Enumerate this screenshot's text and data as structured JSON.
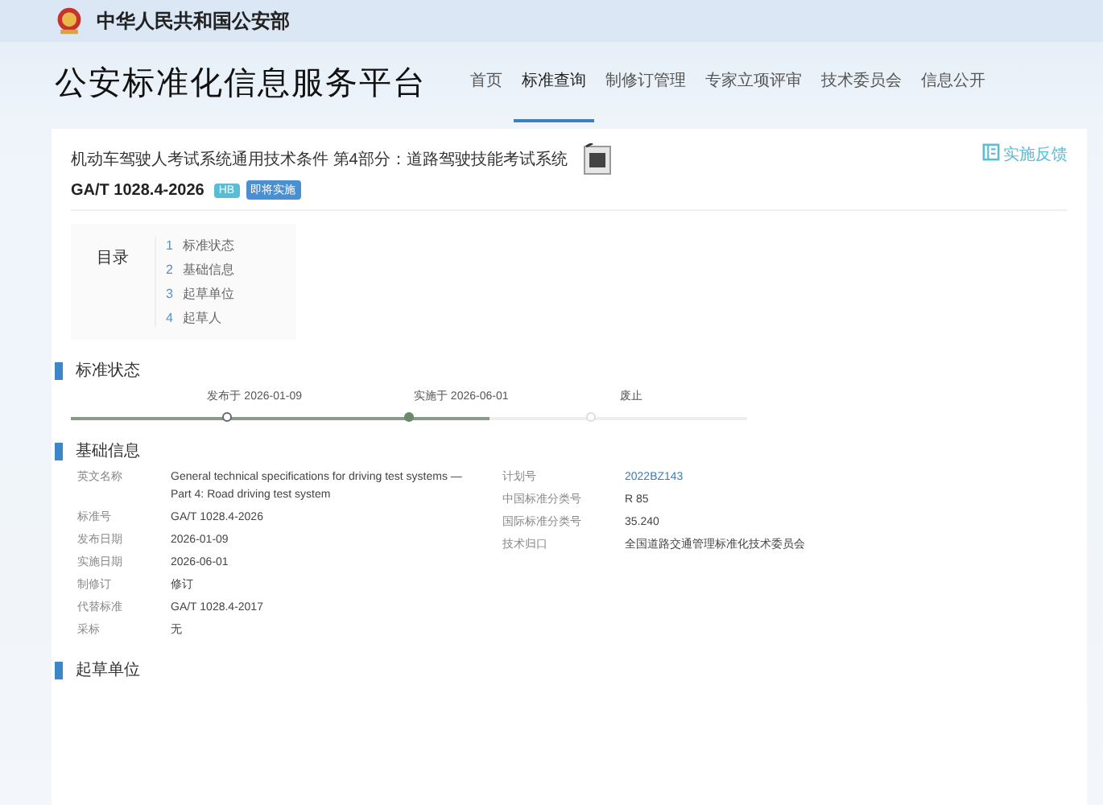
{
  "header": {
    "ministry": "中华人民共和国公安部"
  },
  "platform": {
    "title": "公安标准化信息服务平台"
  },
  "nav": [
    {
      "label": "首页",
      "selected": false
    },
    {
      "label": "标准查询",
      "selected": true
    },
    {
      "label": "制修订管理",
      "selected": false
    },
    {
      "label": "专家立项评审",
      "selected": false
    },
    {
      "label": "技术委员会",
      "selected": false
    },
    {
      "label": "信息公开",
      "selected": false
    }
  ],
  "standard": {
    "title": "机动车驾驶人考试系统通用技术条件 第4部分：道路驾驶技能考试系统",
    "code": "GA/T 1028.4-2026",
    "badges": [
      {
        "label": "HB",
        "color": "#5bbcd6"
      },
      {
        "label": "即将实施",
        "color": "#4a8fd0"
      }
    ],
    "feedback": "实施反馈"
  },
  "toc": {
    "title": "目录",
    "items": [
      {
        "number": "1",
        "label": "标准状态"
      },
      {
        "number": "2",
        "label": "基础信息"
      },
      {
        "number": "3",
        "label": "起草单位"
      },
      {
        "number": "4",
        "label": "起草人"
      }
    ]
  },
  "status": {
    "heading": "标准状态",
    "level": 0.62,
    "stages": [
      {
        "label": "发布于 2026-01-09",
        "kind": "done"
      },
      {
        "label": "实施于 2026-06-01",
        "kind": "current"
      },
      {
        "label": "废止",
        "kind": "pending"
      }
    ]
  },
  "basic_info": {
    "heading": "基础信息",
    "left": [
      {
        "label": "英文名称",
        "value": "General technical specifications for driving test systems — Part 4: Road driving test system",
        "kind": "text"
      },
      {
        "label": "标准号",
        "value": "GA/T 1028.4-2026",
        "kind": "text"
      },
      {
        "label": "发布日期",
        "value": "2026-01-09",
        "kind": "text"
      },
      {
        "label": "实施日期",
        "value": "2026-06-01",
        "kind": "text"
      },
      {
        "label": "制修订",
        "value": "修订",
        "kind": "text"
      },
      {
        "label": "代替标准",
        "value": "GA/T 1028.4-2017",
        "kind": "text"
      },
      {
        "label": "采标",
        "value": "无",
        "kind": "text"
      }
    ],
    "right": [
      {
        "label": "计划号",
        "value": "2022BZ143",
        "kind": "link"
      },
      {
        "label": "中国标准分类号",
        "value": "R 85",
        "kind": "text"
      },
      {
        "label": "国际标准分类号",
        "value": "35.240",
        "kind": "text"
      },
      {
        "label": "技术归口",
        "value": "全国道路交通管理标准化技术委员会",
        "kind": "text"
      }
    ]
  },
  "drafting_units": {
    "heading": "起草单位"
  }
}
